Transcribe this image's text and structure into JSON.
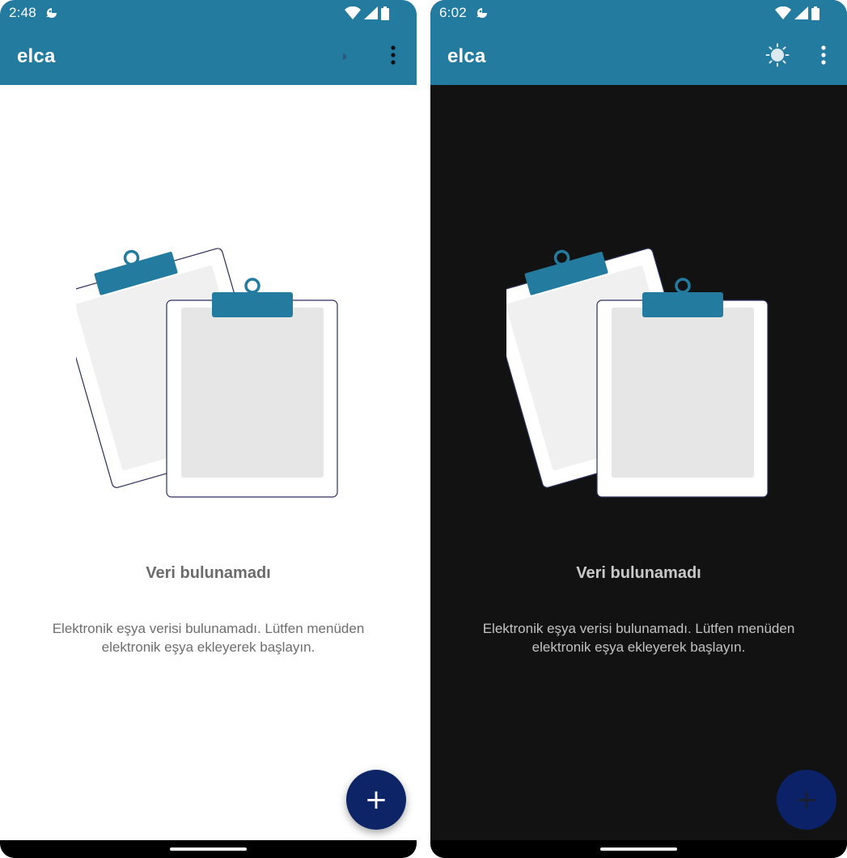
{
  "screens": [
    {
      "theme": "light",
      "status_time": "2:48",
      "app_title": "elca",
      "theme_toggle_icon": "moon-icon",
      "menu_icon": "more-vertical-icon",
      "empty_title": "Veri bulunamadı",
      "empty_desc": "Elektronik eşya verisi bulunamadı. Lütfen menüden elektronik eşya ekleyerek başlayın.",
      "fab_label": "+",
      "background": "#ffffff"
    },
    {
      "theme": "dark",
      "status_time": "6:02",
      "app_title": "elca",
      "theme_toggle_icon": "sun-icon",
      "menu_icon": "more-vertical-icon",
      "empty_title": "Veri bulunamadı",
      "empty_desc": "Elektronik eşya verisi bulunamadı. Lütfen menüden elektronik eşya ekleyerek başlayın.",
      "fab_label": "+",
      "background": "#121212"
    }
  ],
  "colors": {
    "app_bar": "#247ba0",
    "clip": "#247ba0",
    "fab": "#0d2467",
    "dark_background": "#121212"
  }
}
